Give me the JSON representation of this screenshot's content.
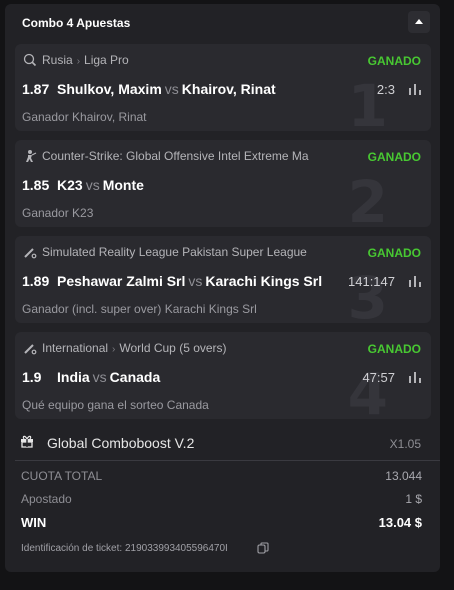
{
  "header": {
    "title": "Combo 4 Apuestas",
    "collapse_icon": "chevron-up-icon"
  },
  "bets": [
    {
      "number": "1",
      "sport_icon": "ping-pong-icon",
      "league": [
        "Rusia",
        "Liga Pro"
      ],
      "result": "GANADO",
      "odds": "1.87",
      "home": "Shulkov, Maxim",
      "vs": "vs",
      "away": "Khairov, Rinat",
      "score": "2:3",
      "selection": "Ganador Khairov, Rinat"
    },
    {
      "number": "2",
      "sport_icon": "counter-strike-icon",
      "league": [
        "Counter-Strike: Global Offensive Intel Extreme Ma"
      ],
      "result": "GANADO",
      "odds": "1.85",
      "home": "K23",
      "vs": "vs",
      "away": "Monte",
      "score": "",
      "selection": "Ganador K23"
    },
    {
      "number": "3",
      "sport_icon": "cricket-icon",
      "league": [
        "Simulated Reality League Pakistan Super League"
      ],
      "result": "GANADO",
      "odds": "1.89",
      "home": "Peshawar Zalmi Srl",
      "vs": "vs",
      "away": "Karachi Kings Srl",
      "score": "141:147",
      "selection": "Ganador (incl. super over) Karachi Kings Srl"
    },
    {
      "number": "4",
      "sport_icon": "cricket-icon",
      "league": [
        "International",
        "World Cup (5 overs)"
      ],
      "result": "GANADO",
      "odds": "1.9",
      "home": "India",
      "vs": "vs",
      "away": "Canada",
      "score": "47:57",
      "selection": "Qué equipo gana el sorteo Canada"
    }
  ],
  "boost": {
    "icon": "gift-icon",
    "label": "Global Comboboost V.2",
    "value": "X1.05"
  },
  "summary": {
    "total_label": "CUOTA TOTAL",
    "total_value": "13.044",
    "staked_label": "Apostado",
    "staked_value": "1 $",
    "win_label": "WIN",
    "win_value": "13.04 $"
  },
  "ticket": {
    "text": "Identificación de ticket: 219033993405596470I",
    "copy_icon": "copy-icon"
  },
  "colors": {
    "win_green": "#48c832",
    "panel": "#222226",
    "card": "#2a2a2f"
  }
}
